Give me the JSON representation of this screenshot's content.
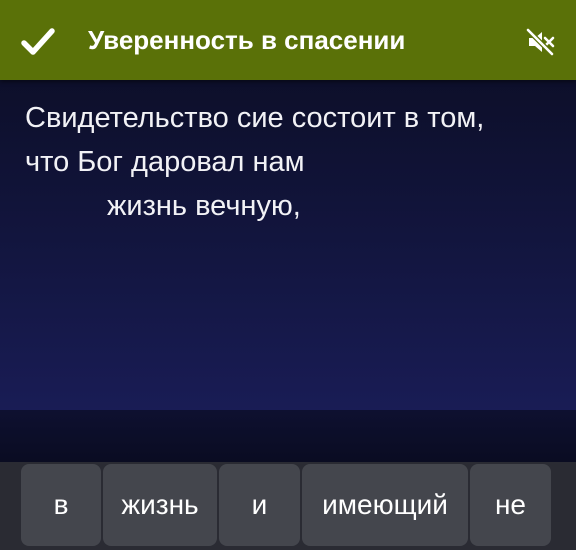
{
  "header": {
    "title": "Уверенность в спасении",
    "confirm_icon": "checkmark-icon",
    "sound_icon": "speaker-muted-icon",
    "background": "#5a7108"
  },
  "verse": {
    "lines": [
      "Свидетельство сие состоит в том,",
      "что Бог даровал нам",
      "жизнь вечную,"
    ]
  },
  "word_choices": [
    "в",
    "жизнь",
    "и",
    "имеющий",
    "не"
  ]
}
